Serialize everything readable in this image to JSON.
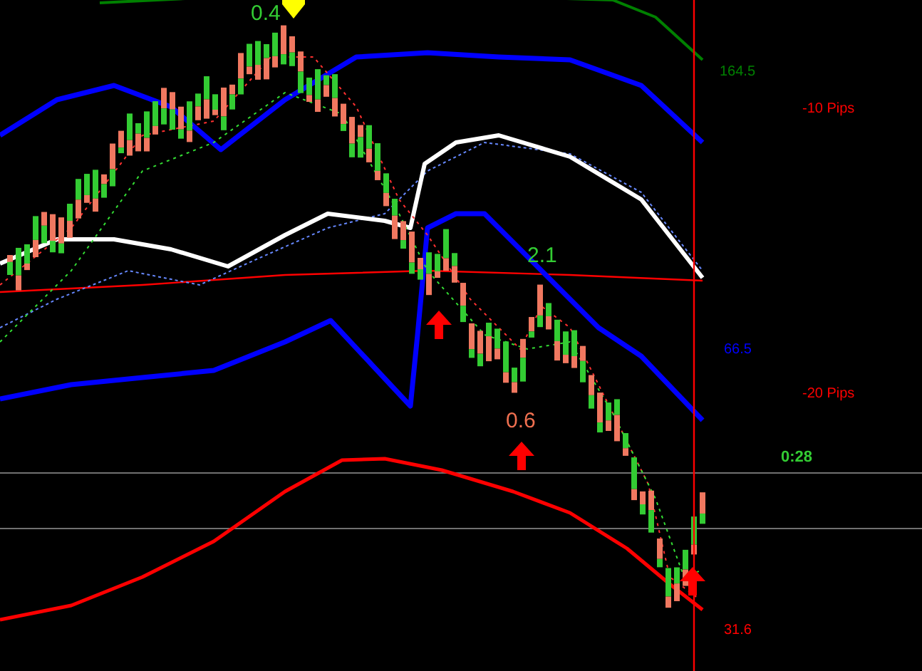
{
  "chart": {
    "signal_labels": [
      {
        "text": "0.4",
        "color": "#33cc33"
      },
      {
        "text": "2.1",
        "color": "#33cc33"
      },
      {
        "text": "0.6",
        "color": "#f07050"
      }
    ],
    "band_values": [
      {
        "text": "164.5",
        "color": "#008000"
      },
      {
        "text": "66.5",
        "color": "#0000ff"
      },
      {
        "text": "31.6",
        "color": "#ff0000"
      }
    ],
    "pip_levels": [
      {
        "text": "-10 Pips"
      },
      {
        "text": "-20 Pips"
      }
    ],
    "countdown": "0:28"
  }
}
